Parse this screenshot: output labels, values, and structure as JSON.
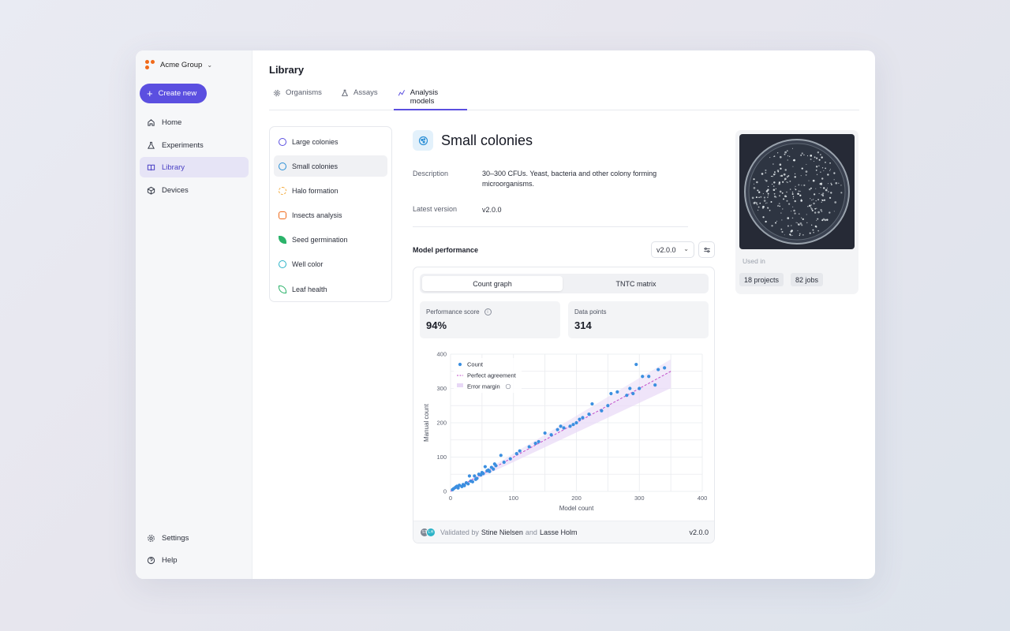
{
  "org": {
    "name": "Acme Group"
  },
  "sidebar": {
    "create_label": "Create new",
    "items": [
      {
        "label": "Home",
        "icon": "home-icon"
      },
      {
        "label": "Experiments",
        "icon": "flask-icon"
      },
      {
        "label": "Library",
        "icon": "book-icon",
        "active": true
      },
      {
        "label": "Devices",
        "icon": "cube-icon"
      }
    ],
    "bottom": [
      {
        "label": "Settings",
        "icon": "gear-icon"
      },
      {
        "label": "Help",
        "icon": "help-icon"
      }
    ]
  },
  "page": {
    "title": "Library"
  },
  "tabs": [
    {
      "label": "Organisms",
      "icon": "cog-icon"
    },
    {
      "label": "Assays",
      "icon": "flask-icon"
    },
    {
      "label": "Analysis models",
      "icon": "graph-icon",
      "active": true
    }
  ],
  "models": [
    {
      "label": "Large colonies",
      "color": "#5b4fe0"
    },
    {
      "label": "Small colonies",
      "color": "#2b8fd6",
      "active": true
    },
    {
      "label": "Halo formation",
      "color": "#f2a530"
    },
    {
      "label": "Insects analysis",
      "color": "#f06a1a"
    },
    {
      "label": "Seed germination",
      "color": "#2bb36a"
    },
    {
      "label": "Well color",
      "color": "#2bb3c7"
    },
    {
      "label": "Leaf health",
      "color": "#2bb36a"
    }
  ],
  "detail": {
    "title": "Small colonies",
    "description_label": "Description",
    "description": "30–300 CFUs. Yeast, bacteria and other colony forming microorganisms.",
    "version_label": "Latest version",
    "version": "v2.0.0"
  },
  "performance": {
    "label": "Model performance",
    "selected_version": "v2.0.0",
    "segments": [
      "Count graph",
      "TNTC matrix"
    ],
    "score_label": "Performance score",
    "score": "94%",
    "points_label": "Data points",
    "points": "314",
    "footer": {
      "prefix": "Validated by",
      "person1": "Stine Nielsen",
      "joiner": "and",
      "person2": "Lasse Holm",
      "initials1": "ST",
      "initials2": "LH",
      "version": "v2.0.0"
    }
  },
  "side": {
    "used_in_label": "Used in",
    "projects": "18 projects",
    "jobs": "82 jobs"
  },
  "chart_data": {
    "type": "scatter",
    "xlabel": "Model count",
    "ylabel": "Manual count",
    "xlim": [
      0,
      400
    ],
    "ylim": [
      0,
      400
    ],
    "xticks": [
      0,
      100,
      200,
      300,
      400
    ],
    "yticks": [
      0,
      100,
      200,
      300,
      400
    ],
    "grid": true,
    "legend": [
      "Count",
      "Perfect agreement",
      "Error margin"
    ],
    "legend_position": "top-left",
    "colors": {
      "points": "#3b8fe0",
      "line": "#c04ec9",
      "band": "#e8d8f6"
    },
    "points": [
      [
        3,
        5
      ],
      [
        5,
        8
      ],
      [
        8,
        12
      ],
      [
        10,
        15
      ],
      [
        12,
        10
      ],
      [
        14,
        18
      ],
      [
        18,
        14
      ],
      [
        20,
        20
      ],
      [
        22,
        17
      ],
      [
        25,
        25
      ],
      [
        28,
        22
      ],
      [
        30,
        45
      ],
      [
        32,
        30
      ],
      [
        35,
        28
      ],
      [
        38,
        45
      ],
      [
        40,
        35
      ],
      [
        42,
        38
      ],
      [
        45,
        50
      ],
      [
        48,
        48
      ],
      [
        50,
        55
      ],
      [
        52,
        52
      ],
      [
        55,
        72
      ],
      [
        58,
        60
      ],
      [
        60,
        62
      ],
      [
        62,
        58
      ],
      [
        65,
        70
      ],
      [
        68,
        65
      ],
      [
        70,
        80
      ],
      [
        72,
        75
      ],
      [
        80,
        105
      ],
      [
        85,
        85
      ],
      [
        95,
        95
      ],
      [
        105,
        110
      ],
      [
        110,
        118
      ],
      [
        125,
        130
      ],
      [
        135,
        140
      ],
      [
        140,
        145
      ],
      [
        150,
        170
      ],
      [
        160,
        165
      ],
      [
        170,
        180
      ],
      [
        175,
        190
      ],
      [
        180,
        185
      ],
      [
        190,
        190
      ],
      [
        195,
        195
      ],
      [
        200,
        200
      ],
      [
        205,
        210
      ],
      [
        210,
        215
      ],
      [
        220,
        225
      ],
      [
        225,
        255
      ],
      [
        240,
        235
      ],
      [
        250,
        250
      ],
      [
        255,
        285
      ],
      [
        265,
        290
      ],
      [
        280,
        280
      ],
      [
        285,
        300
      ],
      [
        290,
        285
      ],
      [
        295,
        370
      ],
      [
        300,
        300
      ],
      [
        305,
        335
      ],
      [
        315,
        335
      ],
      [
        325,
        310
      ],
      [
        330,
        355
      ],
      [
        340,
        360
      ]
    ]
  }
}
